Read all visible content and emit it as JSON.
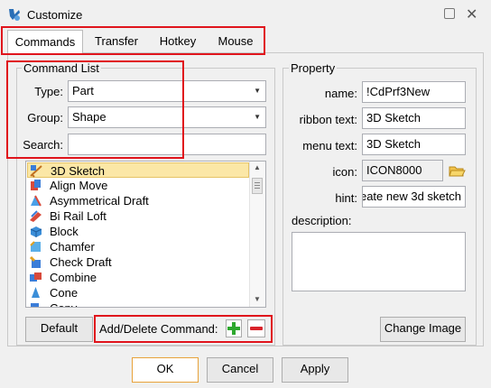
{
  "window": {
    "title": "Customize"
  },
  "tabs": [
    "Commands",
    "Transfer",
    "Hotkey",
    "Mouse"
  ],
  "command_list": {
    "legend": "Command List",
    "type_label": "Type:",
    "type_value": "Part",
    "group_label": "Group:",
    "group_value": "Shape",
    "search_label": "Search:",
    "search_value": "",
    "items": [
      "3D Sketch",
      "Align Move",
      "Asymmetrical Draft",
      "Bi Rail Loft",
      "Block",
      "Chamfer",
      "Check Draft",
      "Combine",
      "Cone",
      "Copy"
    ],
    "selected_index": 0,
    "default_button": "Default",
    "add_delete_label": "Add/Delete Command:"
  },
  "property": {
    "legend": "Property",
    "name_label": "name:",
    "name_value": "!CdPrf3New",
    "ribbon_label": "ribbon text:",
    "ribbon_value": "3D Sketch",
    "menu_label": "menu text:",
    "menu_value": "3D Sketch",
    "icon_label": "icon:",
    "icon_value": "ICON8000",
    "hint_label": "hint:",
    "hint_value": "eate new 3d sketch",
    "description_label": "description:",
    "description_value": "",
    "change_image_button": "Change Image"
  },
  "footer": {
    "ok": "OK",
    "cancel": "Cancel",
    "apply": "Apply"
  },
  "colors": {
    "highlight": "#e0141c",
    "selection": "#fbe7a6",
    "add_green": "#2ea82e",
    "remove_red": "#d9232a"
  }
}
